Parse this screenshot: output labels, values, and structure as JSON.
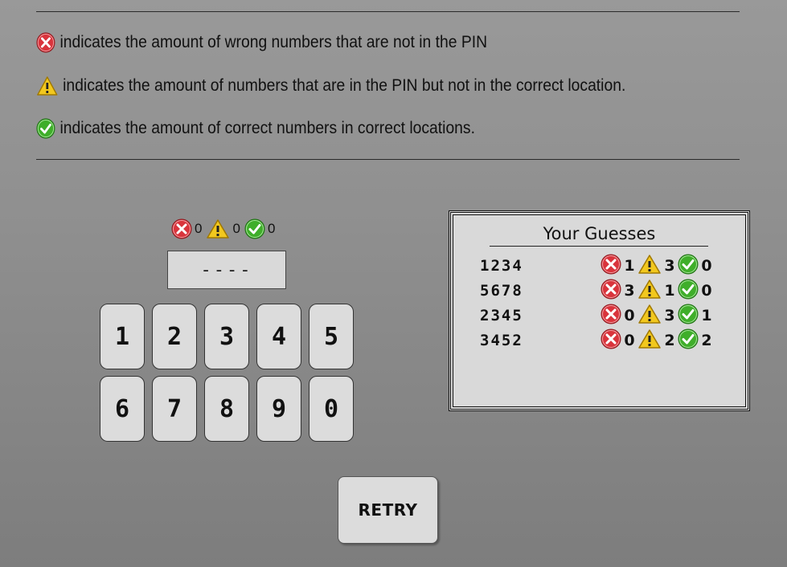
{
  "legend": {
    "wrong_text": "indicates the amount of wrong numbers that are not in the PIN",
    "misplaced_text": "indicates the amount of numbers that are in the PIN but not in the correct location.",
    "correct_text": "indicates the amount of correct numbers in correct locations."
  },
  "current": {
    "wrong": "0",
    "misplaced": "0",
    "correct": "0",
    "pin_display": "----"
  },
  "keypad": [
    "1",
    "2",
    "3",
    "4",
    "5",
    "6",
    "7",
    "8",
    "9",
    "0"
  ],
  "guesses": {
    "title": "Your Guesses",
    "rows": [
      {
        "code": "1234",
        "wrong": "1",
        "misplaced": "3",
        "correct": "0"
      },
      {
        "code": "5678",
        "wrong": "3",
        "misplaced": "1",
        "correct": "0"
      },
      {
        "code": "2345",
        "wrong": "0",
        "misplaced": "3",
        "correct": "1"
      },
      {
        "code": "3452",
        "wrong": "0",
        "misplaced": "2",
        "correct": "2"
      }
    ]
  },
  "retry_label": "RETRY",
  "icons": {
    "wrong": "x-circle-icon",
    "misplaced": "warning-icon",
    "correct": "check-circle-icon"
  },
  "colors": {
    "wrong": "#d9343c",
    "misplaced": "#f2c81e",
    "correct": "#3fae2a"
  }
}
